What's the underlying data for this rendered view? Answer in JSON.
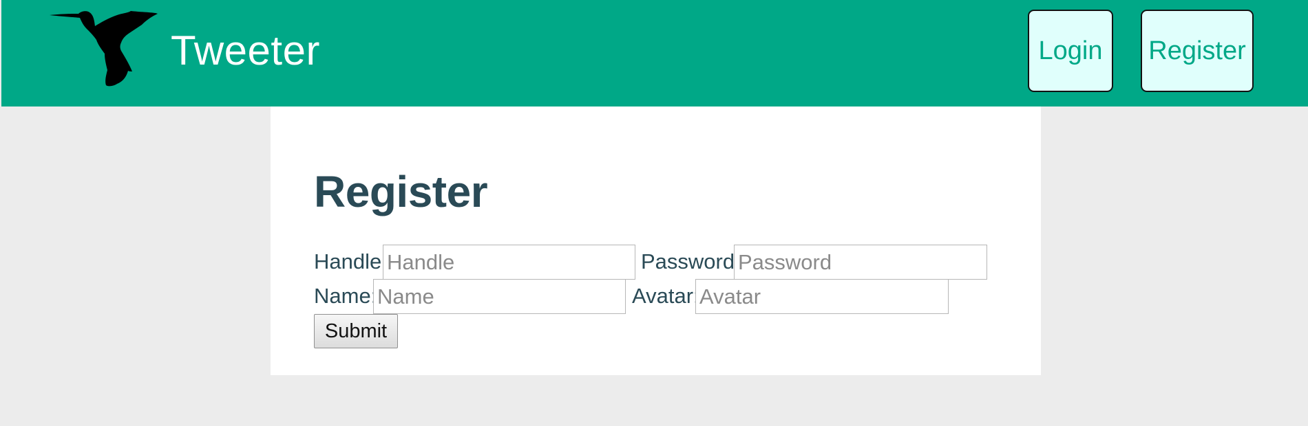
{
  "header": {
    "brand": "Tweeter",
    "logo_icon": "hummingbird-icon",
    "nav": {
      "login_label": "Login",
      "register_label": "Register"
    },
    "colors": {
      "bar": "#00a887",
      "button_bg": "#e0fffc",
      "button_text": "#00a887"
    }
  },
  "form": {
    "title": "Register",
    "fields": {
      "handle": {
        "label": "Handle:",
        "placeholder": "Handle",
        "value": ""
      },
      "password": {
        "label": "Password:",
        "placeholder": "Password",
        "value": ""
      },
      "name": {
        "label": "Name:",
        "placeholder": "Name",
        "value": ""
      },
      "avatar": {
        "label": "Avatar:",
        "placeholder": "Avatar",
        "value": ""
      }
    },
    "submit_label": "Submit",
    "title_color": "#2a4a56"
  }
}
